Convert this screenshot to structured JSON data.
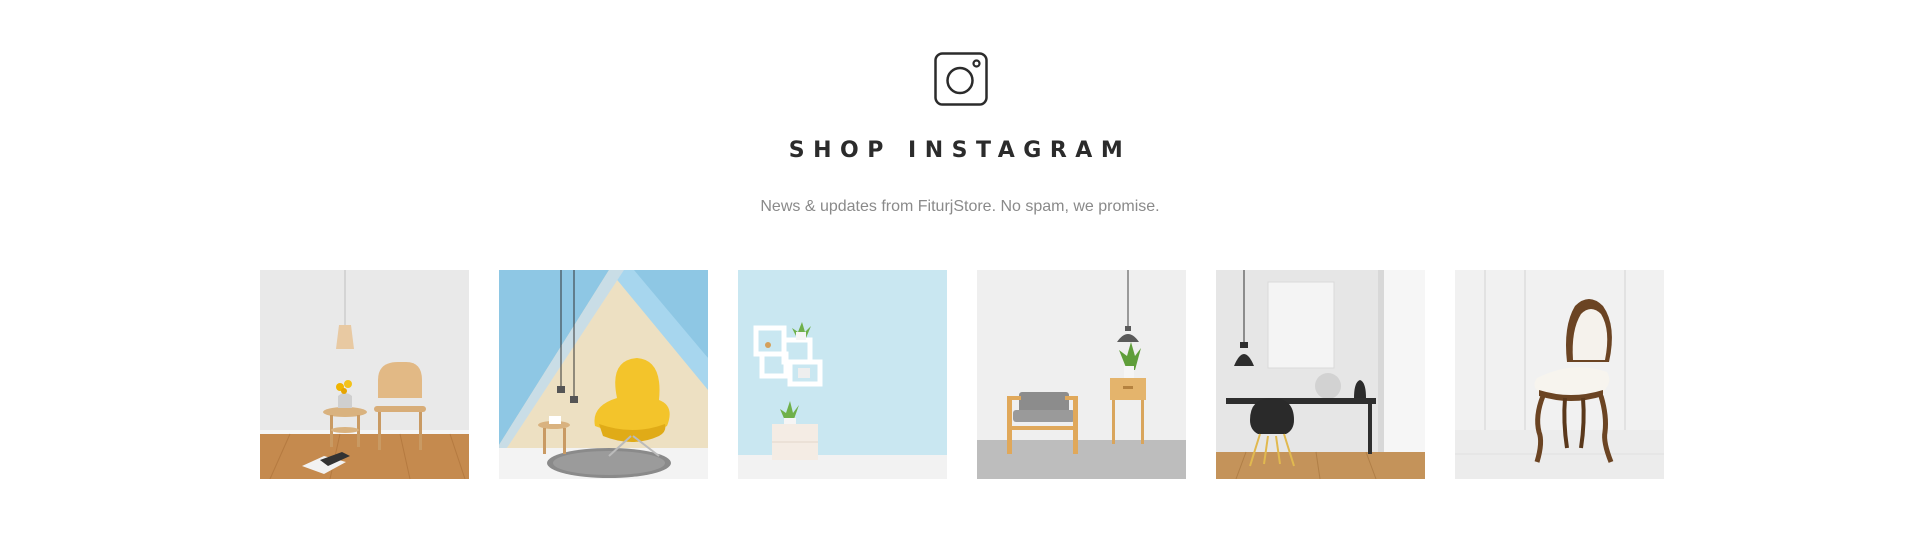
{
  "section": {
    "icon": "instagram-icon",
    "title": "SHOP INSTAGRAM",
    "subtitle": "News & updates from FiturjStore. No spam, we promise."
  },
  "gallery": {
    "images": [
      {
        "name": "wooden-chair-sunflower-table",
        "description": "Wooden chair with side table, sunflower vase and pendant lamp"
      },
      {
        "name": "yellow-lounge-chair",
        "description": "Yellow lounge chair with blue geometric wall and pendant lamps"
      },
      {
        "name": "wall-shelves-plant",
        "description": "Light blue wall with white cube shelves and potted plants"
      },
      {
        "name": "grey-armchair-side-table",
        "description": "Grey armchair with wooden side table and pendant lamp"
      },
      {
        "name": "black-chair-desk",
        "description": "Black chair at desk with lamp and framed canvas"
      },
      {
        "name": "vintage-white-chair",
        "description": "Vintage carved wooden chair with white upholstery"
      }
    ]
  },
  "colors": {
    "title": "#2b2b2b",
    "subtitle": "#8a8a8a",
    "background": "#ffffff"
  }
}
